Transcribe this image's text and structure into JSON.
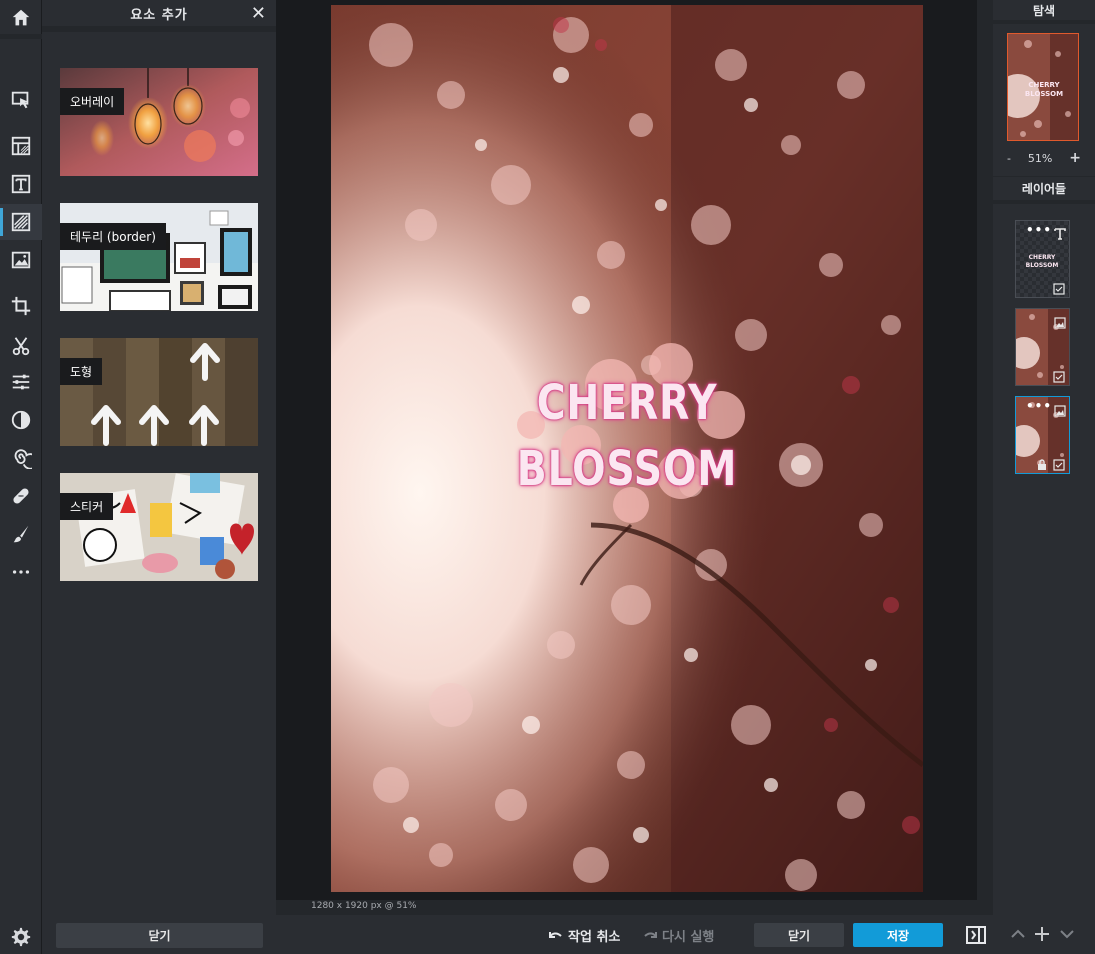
{
  "toolbar": {
    "tools": [
      "home-icon",
      "arrange-icon",
      "layout-icon",
      "text-icon",
      "add-element-icon",
      "image-icon",
      "crop-icon",
      "cutout-icon",
      "adjust-icon",
      "filter-icon",
      "liquify-icon",
      "healing-icon",
      "brush-icon",
      "more-icon"
    ],
    "active_tool": "add-element-icon"
  },
  "panel": {
    "title": "요소 추가",
    "close_symbol": "✕",
    "cards": [
      {
        "label": "오버레이"
      },
      {
        "label": "테두리 (border)"
      },
      {
        "label": "도형"
      },
      {
        "label": "스티커"
      }
    ],
    "close_button": "닫기"
  },
  "canvas": {
    "text_line1": "CHERRY",
    "text_line2": "BLOSSOM",
    "status": "1280 x 1920 px @ 51%"
  },
  "bottom": {
    "undo": "작업 취소",
    "redo": "다시 실행",
    "close": "닫기",
    "save": "저장"
  },
  "right_panel": {
    "navigator_title": "탐색",
    "zoom_out": "-",
    "zoom_value": "51%",
    "zoom_in": "+",
    "layers_title": "레이어들",
    "thumb_text": "CHERRY BLOSSOM",
    "layers": [
      {
        "type": "text",
        "label_line1": "CHERRY",
        "label_line2": "BLOSSOM",
        "selected": false
      },
      {
        "type": "image",
        "selected": false
      },
      {
        "type": "image",
        "locked": true,
        "selected": true
      }
    ]
  },
  "colors": {
    "accent": "#129bd8",
    "panel_bg": "#2a2d32",
    "workspace_bg": "#1e2024",
    "glow_pink": "#e04b94"
  }
}
